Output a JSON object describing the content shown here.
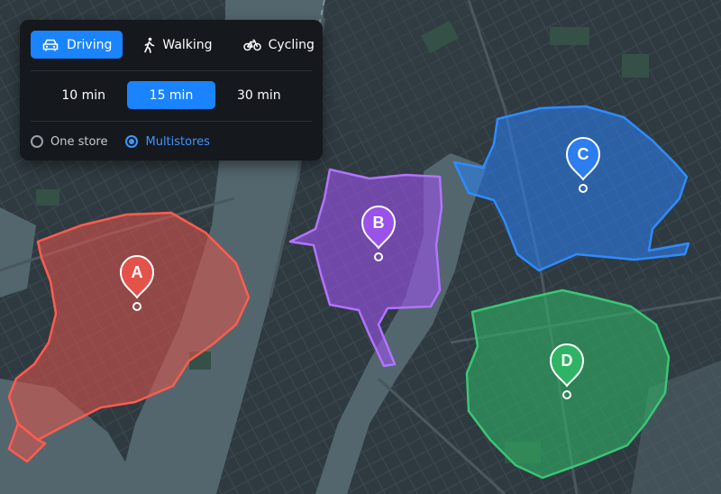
{
  "panel": {
    "modes": [
      {
        "label": "Driving",
        "icon": "car-icon",
        "active": true
      },
      {
        "label": "Walking",
        "icon": "walking-icon",
        "active": false
      },
      {
        "label": "Cycling",
        "icon": "bicycle-icon",
        "active": false
      }
    ],
    "times": [
      {
        "label": "10 min",
        "active": false
      },
      {
        "label": "15 min",
        "active": true
      },
      {
        "label": "30 min",
        "active": false
      }
    ],
    "store_options": [
      {
        "label": "One store",
        "selected": false
      },
      {
        "label": "Multistores",
        "selected": true
      }
    ]
  },
  "zones": [
    {
      "label": "A",
      "color": "#e4534a"
    },
    {
      "label": "B",
      "color": "#9a52e8"
    },
    {
      "label": "C",
      "color": "#2b7df0"
    },
    {
      "label": "D",
      "color": "#2fb365"
    }
  ],
  "colors": {
    "accent": "#1a84ff",
    "panel_bg": "#15181d",
    "water": "#53666d",
    "land": "#2f3a40"
  }
}
